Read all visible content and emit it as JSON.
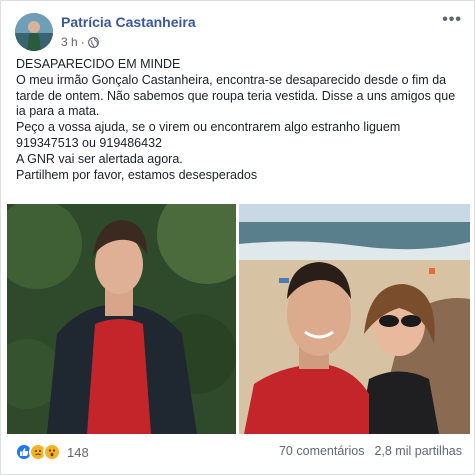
{
  "post": {
    "author": "Patrícia Castanheira",
    "time": "3 h",
    "privacy_icon": "globe-icon",
    "more_icon": "•••",
    "lines": [
      "DESAPARECIDO EM MINDE",
      "O meu irmão Gonçalo Castanheira, encontra-se desaparecido desde o fim da tarde de ontem. Não sabemos que roupa teria vestida. Disse a uns amigos que ia para a mata.",
      "Peço a vossa ajuda, se o virem ou encontrarem algo estranho liguem",
      "919347513 ou 919486432",
      "A GNR vai ser alertada agora.",
      "Partilhem por favor, estamos desesperados"
    ]
  },
  "footer": {
    "reaction_icons": [
      "like-icon",
      "sad-icon",
      "wow-icon"
    ],
    "reaction_count": "148",
    "comments": "70 comentários",
    "shares": "2,8 mil partilhas"
  },
  "colors": {
    "link": "#385898",
    "like": "#2078f4",
    "sad": "#f7b125"
  }
}
